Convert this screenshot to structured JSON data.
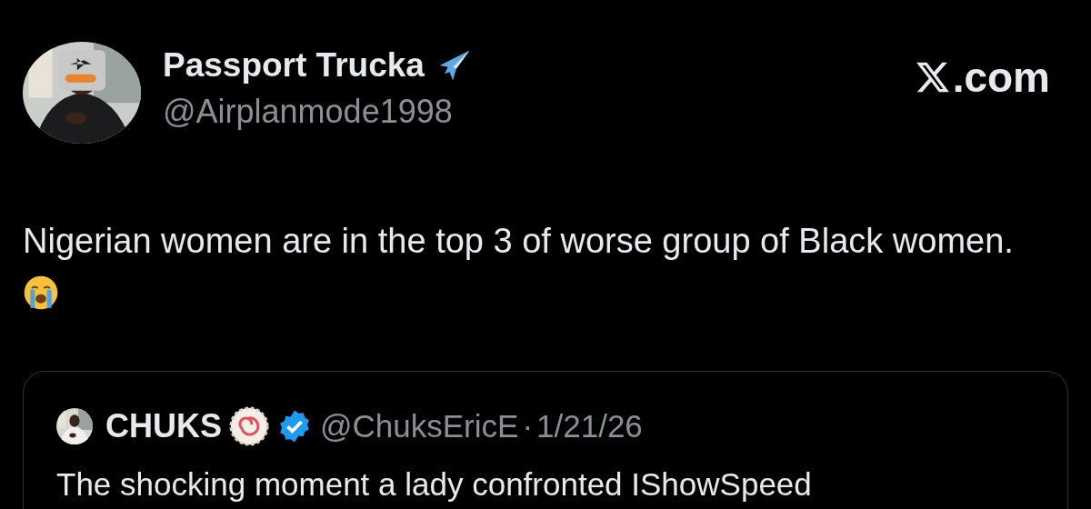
{
  "author": {
    "name": "Passport Trucka",
    "handle": "@Airplanmode1998"
  },
  "brand": {
    "suffix": ".com"
  },
  "post": {
    "text": "Nigerian women are in the top 3 of worse group of Black women."
  },
  "quote": {
    "author": {
      "name": "CHUKS",
      "handle": "@ChuksEricE",
      "verified": true
    },
    "separator": "·",
    "date": "1/21/26",
    "text": "The shocking moment a lady confronted IShowSpeed"
  }
}
